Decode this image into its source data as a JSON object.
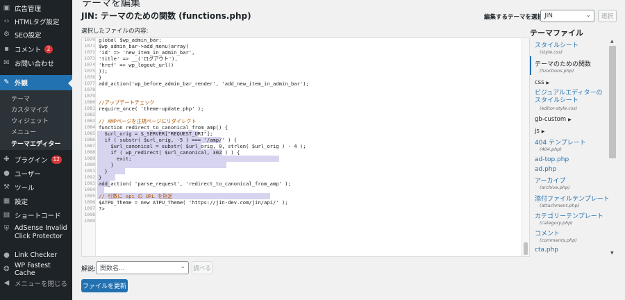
{
  "sidebar": {
    "items": [
      {
        "icon": "media-icon",
        "label": "広告管理"
      },
      {
        "icon": "code-icon",
        "label": "HTMLタグ設定"
      },
      {
        "icon": "gear-icon",
        "label": "SEO設定"
      },
      {
        "icon": "comment-icon",
        "label": "コメント",
        "badge": "2"
      },
      {
        "icon": "mail-icon",
        "label": "お問い合わせ"
      },
      {
        "icon": "brush-icon",
        "label": "外観"
      },
      {
        "icon": "plugin-icon",
        "label": "プラグイン",
        "badge": "12"
      },
      {
        "icon": "user-icon",
        "label": "ユーザー"
      },
      {
        "icon": "wrench-icon",
        "label": "ツール"
      },
      {
        "icon": "settings-icon",
        "label": "設定"
      },
      {
        "icon": "shortcode-icon",
        "label": "ショートコード"
      },
      {
        "icon": "adsense-icon",
        "label": "AdSense Invalid Click Protector"
      },
      {
        "icon": "link-icon",
        "label": "Link Checker"
      },
      {
        "icon": "cheetah-icon",
        "label": "WP Fastest Cache"
      },
      {
        "icon": "collapse-icon",
        "label": "メニューを閉じる"
      }
    ],
    "submenu": [
      "テーマ",
      "カスタマイズ",
      "ウィジェット",
      "メニュー",
      "テーマエディター"
    ]
  },
  "header": {
    "page_title": "テーマを編集",
    "file_title": "JIN: テーマのための関数 (functions.php)",
    "choose_theme_label": "編集するテーマを選択:",
    "theme_selected": "JIN",
    "choose_button": "選択",
    "content_label": "選択したファイルの内容:"
  },
  "editor": {
    "line_numbers": [
      "1070",
      "1071",
      "1072",
      "1073",
      "1074",
      "1075",
      "1076",
      "1077",
      "1078",
      "1079",
      "1080",
      "1081",
      "1082",
      "1083",
      "1084",
      "1085",
      "1086",
      "1087",
      "1088",
      "1089",
      "1090",
      "1091",
      "1092",
      "1093",
      "1094",
      "1095",
      "1096",
      "1097",
      "1098",
      "1099"
    ],
    "lines": [
      "global $wp_admin_bar;",
      "$wp_admin_bar->add_menu(array(",
      "'id' => 'new_item_in_admin_bar',",
      "'title' => __('ログアウト'),",
      "'href' => wp_logout_url()",
      "));",
      "}",
      "add_action('wp_before_admin_bar_render', 'add_new_item_in_admin_bar');",
      "",
      "",
      "//アップデートチェック",
      "require_once( 'theme-update.php' );",
      "",
      "// AMPページを正規ページにリダイレクト",
      "function redirect_to_canonical_from_amp() {",
      "  $url_orig = $_SERVER[\"REQUEST_URI\"];",
      "  if ( substr( $url_orig, -5 ) === '/amp/' ) {",
      "    $url_canonical = substr( $url_orig, 0, strlen( $url_orig ) - 4 );",
      "    if ( wp_redirect( $url_canonical, 302 ) ) {",
      "      exit;",
      "    }",
      "  }",
      "}",
      "add_action( 'parse_request', 'redirect_to_canonical_from_amp' );",
      "",
      "// 引数に api の URL を指定",
      "$ATPU_Theme = new ATPU_Theme( 'https://jin-dev.com/jin/api/' );",
      "?>",
      "",
      ""
    ]
  },
  "bottom": {
    "doc_label": "解説:",
    "func_placeholder": "関数名...",
    "lookup_button": "調べる",
    "update_button": "ファイルを更新"
  },
  "files": {
    "heading": "テーマファイル",
    "entries": [
      {
        "name": "スタイルシート",
        "file": "(style.css)"
      },
      {
        "name": "テーマのための関数",
        "file": "(functions.php)"
      },
      {
        "folder": "css"
      },
      {
        "name": "ビジュアルエディターのスタイルシート",
        "file": "(editor-style.css)"
      },
      {
        "folder": "gb-custom"
      },
      {
        "folder": "js"
      },
      {
        "name": "404 テンプレート",
        "file": "(404.php)"
      },
      {
        "name": "ad-top.php"
      },
      {
        "name": "ad.php"
      },
      {
        "name": "アーカイブ",
        "file": "(archive.php)"
      },
      {
        "name": "添付ファイルテンプレート",
        "file": "(attachment.php)"
      },
      {
        "name": "カテゴリーテンプレート",
        "file": "(category.php)"
      },
      {
        "name": "コメント",
        "file": "(comments.php)"
      },
      {
        "name": "cta.php"
      }
    ]
  },
  "colors": {
    "accent": "#2271b1",
    "sidebar_bg": "#1d2327",
    "badge": "#d63638",
    "highlight": "#d7d4f0"
  }
}
